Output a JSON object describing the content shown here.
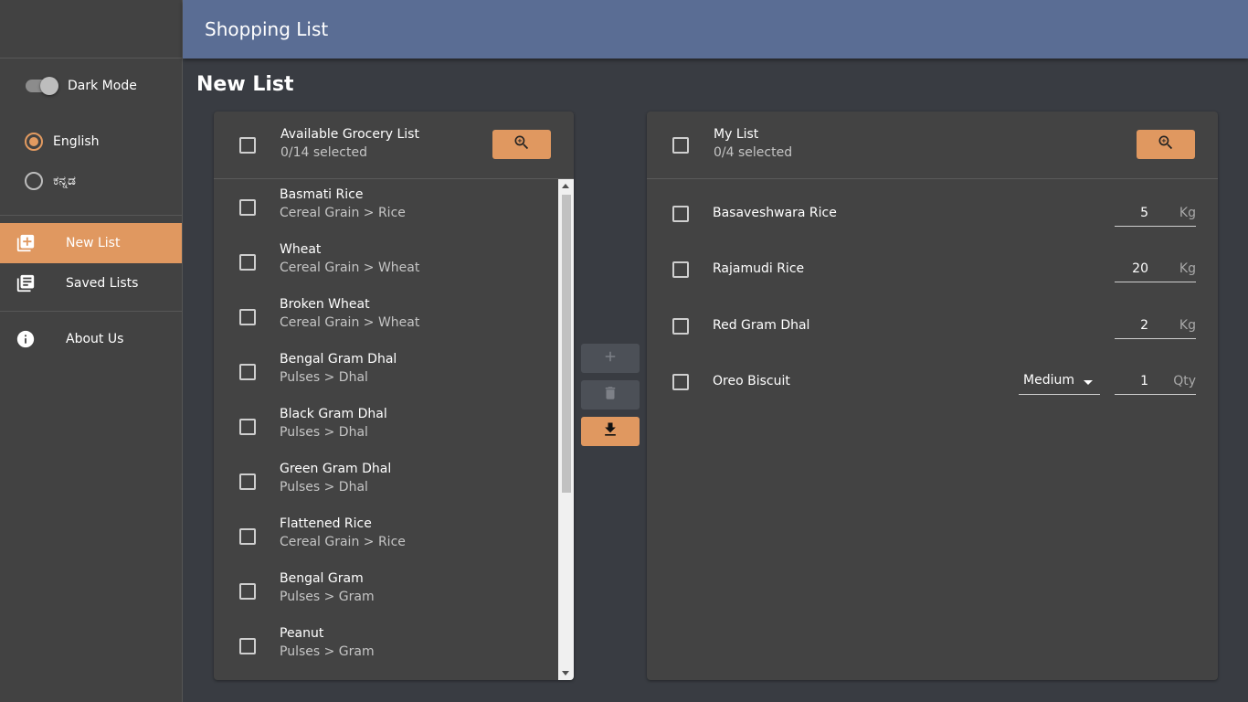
{
  "header": {
    "title": "Shopping List"
  },
  "sidebar": {
    "dark_mode_label": "Dark Mode",
    "languages": [
      {
        "label": "English",
        "selected": true
      },
      {
        "label": "ಕನ್ನಡ",
        "selected": false
      }
    ],
    "nav": [
      {
        "label": "New List",
        "icon": "add-box-icon",
        "active": true
      },
      {
        "label": "Saved Lists",
        "icon": "library-books-icon",
        "active": false
      },
      {
        "label": "About Us",
        "icon": "info-icon",
        "active": false
      }
    ]
  },
  "page": {
    "title": "New List"
  },
  "available": {
    "title": "Available Grocery List",
    "selected_text": "0/14 selected",
    "items": [
      {
        "name": "Basmati Rice",
        "category": "Cereal Grain > Rice"
      },
      {
        "name": "Wheat",
        "category": "Cereal Grain > Wheat"
      },
      {
        "name": "Broken Wheat",
        "category": "Cereal Grain > Wheat"
      },
      {
        "name": "Bengal Gram Dhal",
        "category": "Pulses > Dhal"
      },
      {
        "name": "Black Gram Dhal",
        "category": "Pulses > Dhal"
      },
      {
        "name": "Green Gram Dhal",
        "category": "Pulses > Dhal"
      },
      {
        "name": "Flattened Rice",
        "category": "Cereal Grain > Rice"
      },
      {
        "name": "Bengal Gram",
        "category": "Pulses > Gram"
      },
      {
        "name": "Peanut",
        "category": "Pulses > Gram"
      }
    ]
  },
  "my_list": {
    "title": "My List",
    "selected_text": "0/4 selected",
    "items": [
      {
        "name": "Basaveshwara Rice",
        "quantity": "5",
        "unit": "Kg"
      },
      {
        "name": "Rajamudi Rice",
        "quantity": "20",
        "unit": "Kg"
      },
      {
        "name": "Red Gram Dhal",
        "quantity": "2",
        "unit": "Kg"
      },
      {
        "name": "Oreo Biscuit",
        "size": "Medium",
        "quantity": "1",
        "unit": "Qty"
      }
    ]
  },
  "colors": {
    "accent": "#e09860",
    "header": "#5a6d94",
    "sidebar": "#424242",
    "background": "#393c42",
    "panel": "#434343"
  }
}
